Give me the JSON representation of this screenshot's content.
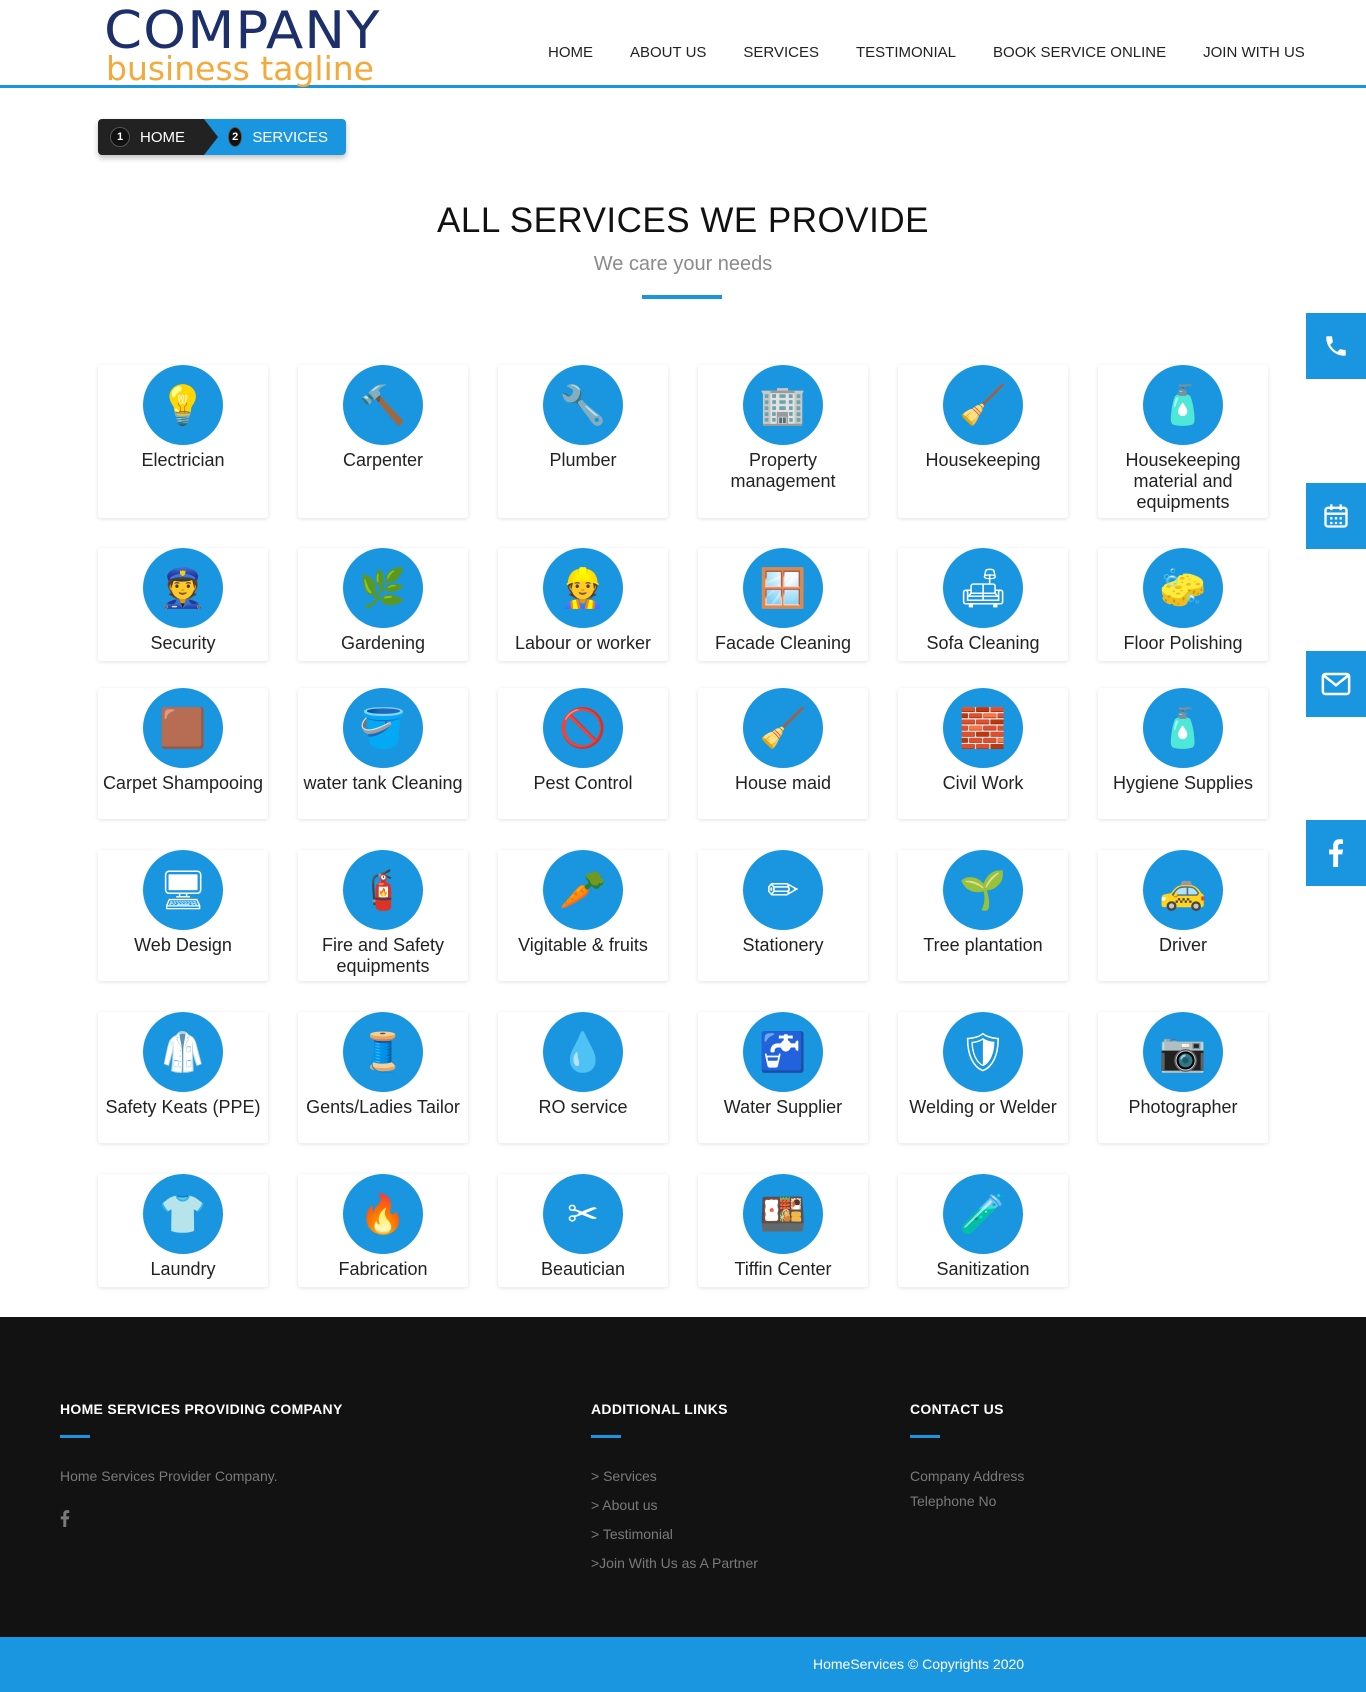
{
  "logo": {
    "line1": "COMPANY",
    "line2": "business tagline"
  },
  "nav": [
    "HOME",
    "ABOUT US",
    "SERVICES",
    "TESTIMONIAL",
    "BOOK SERVICE ONLINE",
    "JOIN WITH US"
  ],
  "breadcrumb": [
    {
      "num": "1",
      "label": "HOME"
    },
    {
      "num": "2",
      "label": "SERVICES"
    }
  ],
  "heading": {
    "title": "ALL SERVICES WE PROVIDE",
    "subtitle": "We care your needs"
  },
  "services": [
    {
      "label": "Electrician",
      "icon": "bulb-icon"
    },
    {
      "label": "Carpenter",
      "icon": "hammer-icon"
    },
    {
      "label": "Plumber",
      "icon": "plumber-icon"
    },
    {
      "label": "Property management",
      "icon": "property-icon"
    },
    {
      "label": "Housekeeping",
      "icon": "broom-icon"
    },
    {
      "label": "Housekeeping material and equipments",
      "icon": "cleaning-supplies-icon"
    },
    {
      "label": "Security",
      "icon": "security-guard-icon"
    },
    {
      "label": "Gardening",
      "icon": "plant-hand-icon"
    },
    {
      "label": "Labour or worker",
      "icon": "worker-icon"
    },
    {
      "label": "Facade Cleaning",
      "icon": "window-cleaning-icon"
    },
    {
      "label": "Sofa Cleaning",
      "icon": "sofa-icon"
    },
    {
      "label": "Floor Polishing",
      "icon": "mop-icon"
    },
    {
      "label": "Carpet Shampooing",
      "icon": "carpet-icon"
    },
    {
      "label": "water tank Cleaning",
      "icon": "bucket-icon"
    },
    {
      "label": "Pest Control",
      "icon": "pest-spray-icon"
    },
    {
      "label": "House maid",
      "icon": "vacuum-icon"
    },
    {
      "label": "Civil Work",
      "icon": "brick-wall-icon"
    },
    {
      "label": "Hygiene Supplies",
      "icon": "sanitizer-icon"
    },
    {
      "label": "Web Design",
      "icon": "monitor-icon"
    },
    {
      "label": "Fire and Safety equipments",
      "icon": "fire-extinguisher-icon"
    },
    {
      "label": "Vigitable & fruits",
      "icon": "vegetable-basket-icon"
    },
    {
      "label": "Stationery",
      "icon": "pencils-icon"
    },
    {
      "label": "Tree plantation",
      "icon": "sapling-icon"
    },
    {
      "label": "Driver",
      "icon": "driver-icon"
    },
    {
      "label": "Safety Keats (PPE)",
      "icon": "ppe-suit-icon"
    },
    {
      "label": "Gents/Ladies Tailor",
      "icon": "sewing-icon"
    },
    {
      "label": "RO service",
      "icon": "water-filter-icon"
    },
    {
      "label": "Water Supplier",
      "icon": "water-bottle-icon"
    },
    {
      "label": "Welding or Welder",
      "icon": "welding-mask-icon"
    },
    {
      "label": "Photographer",
      "icon": "camera-man-icon"
    },
    {
      "label": "Laundry",
      "icon": "laundry-icon"
    },
    {
      "label": "Fabrication",
      "icon": "torch-icon"
    },
    {
      "label": "Beautician",
      "icon": "beauty-tools-icon"
    },
    {
      "label": "Tiffin Center",
      "icon": "tiffin-box-icon"
    },
    {
      "label": "Sanitization",
      "icon": "spray-bottle-icon"
    }
  ],
  "side_buttons": [
    "phone-icon",
    "calendar-icon",
    "mail-icon",
    "facebook-icon"
  ],
  "footer": {
    "col1": {
      "title": "HOME SERVICES PROVIDING COMPANY",
      "text": "Home Services Provider Company."
    },
    "col2": {
      "title": "ADDITIONAL LINKS",
      "links": [
        "> Services",
        "> About us",
        "> Testimonial",
        ">Join With Us as A Partner"
      ]
    },
    "col3": {
      "title": "CONTACT US",
      "address": "Company Address",
      "phone": "Telephone No"
    },
    "copyright": "HomeServices © Copyrights 2020"
  },
  "colors": {
    "accent": "#1a96e0",
    "dark": "#121212",
    "logo_blue": "#1c2f6b",
    "logo_orange": "#f4a93a"
  }
}
